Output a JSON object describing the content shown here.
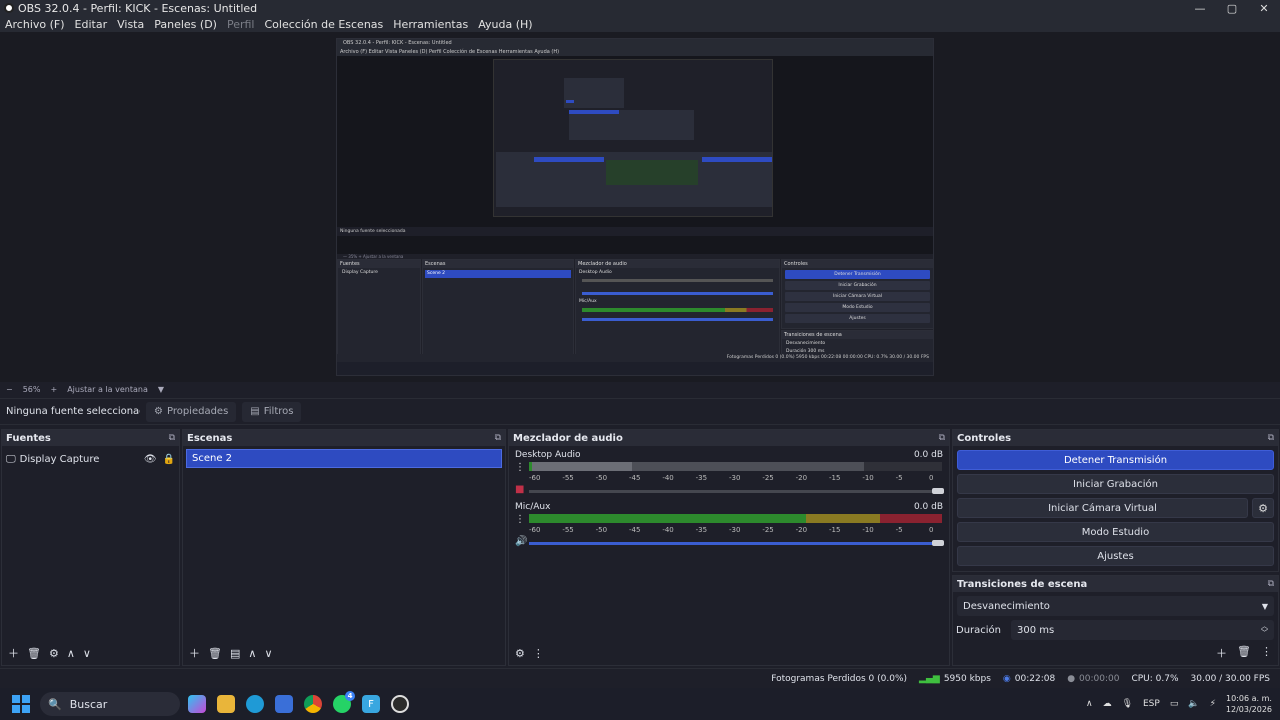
{
  "window": {
    "title": "OBS 32.0.4 - Perfil: KICK - Escenas: Untitled",
    "controls": [
      "—",
      "▢",
      "✕"
    ]
  },
  "menu": [
    {
      "label": "Archivo (F)",
      "disabled": false
    },
    {
      "label": "Editar",
      "disabled": false
    },
    {
      "label": "Vista",
      "disabled": false
    },
    {
      "label": "Paneles (D)",
      "disabled": false
    },
    {
      "label": "Perfil",
      "disabled": true
    },
    {
      "label": "Colección de Escenas",
      "disabled": false
    },
    {
      "label": "Herramientas",
      "disabled": false
    },
    {
      "label": "Ayuda (H)",
      "disabled": false
    }
  ],
  "zoom": {
    "minus": "−",
    "value": "56%",
    "plus": "+",
    "fit_label": "Ajustar a la ventana"
  },
  "source_toolbar": {
    "no_selection": "Ninguna fuente seleccionada",
    "properties": "Propiedades",
    "filters": "Filtros"
  },
  "docks": {
    "sources": {
      "title": "Fuentes",
      "items": [
        {
          "label": "Display Capture"
        }
      ]
    },
    "scenes": {
      "title": "Escenas",
      "items": [
        {
          "label": "Scene 2",
          "selected": true
        }
      ]
    },
    "mixer": {
      "title": "Mezclador de audio",
      "ticks": [
        "-60",
        "-55",
        "-50",
        "-45",
        "-40",
        "-35",
        "-30",
        "-25",
        "-20",
        "-15",
        "-10",
        "-5",
        "0"
      ],
      "channels": [
        {
          "name": "Desktop Audio",
          "level": "0.0 dB",
          "muted": true
        },
        {
          "name": "Mic/Aux",
          "level": "0.0 dB",
          "muted": false
        }
      ]
    },
    "controls": {
      "title": "Controles",
      "buttons": [
        "Detener Transmisión",
        "Iniciar Grabación",
        "Iniciar Cámara Virtual",
        "Modo Estudio",
        "Ajustes"
      ]
    },
    "transitions": {
      "title": "Transiciones de escena",
      "selected": "Desvanecimiento",
      "duration_label": "Duración",
      "duration_value": "300 ms"
    }
  },
  "status": {
    "dropped": "Fotogramas Perdidos 0 (0.0%)",
    "bitrate": "5950 kbps",
    "stream_time": "00:22:08",
    "rec_time": "00:00:00",
    "cpu": "CPU: 0.7%",
    "fps": "30.00 / 30.00 FPS"
  },
  "taskbar": {
    "search": "Buscar",
    "lang": "ESP",
    "time": "10:06 a. m.",
    "date": "12/03/2026",
    "whatsapp_badge": "4"
  },
  "mini_preview": {
    "title": "OBS 32.0.4 - Perfil: KICK - Escenas: Untitled",
    "menu": "Archivo (F)   Editar   Vista   Paneles (D)   Perfil   Colección de Escenas   Herramientas   Ayuda (H)",
    "no_selection": "Ninguna fuente seleccionada",
    "sources_title": "Fuentes",
    "source": "Display Capture",
    "scenes_title": "Escenas",
    "scene": "Scene 2",
    "mixer_title": "Mezclador de audio",
    "ch1": "Desktop Audio",
    "ch2": "Mic/Aux",
    "controls_title": "Controles",
    "b1": "Detener Transmisión",
    "b2": "Iniciar Grabación",
    "b3": "Iniciar Cámara Virtual",
    "b4": "Modo Estudio",
    "b5": "Ajustes",
    "trans_title": "Transiciones de escena",
    "trans": "Desvanecimiento",
    "duration": "Duración   300 ms",
    "status": "Fotogramas Perdidos 0 (0.0%)   5950 kbps   00:22:08   00:00:00   CPU: 0.7%   30.00 / 30.00 FPS"
  },
  "colors": {
    "accent": "#2e4bc1",
    "meter_green": "#2d8a2d",
    "meter_yellow": "#8a7a22",
    "meter_red": "#8a2230"
  }
}
